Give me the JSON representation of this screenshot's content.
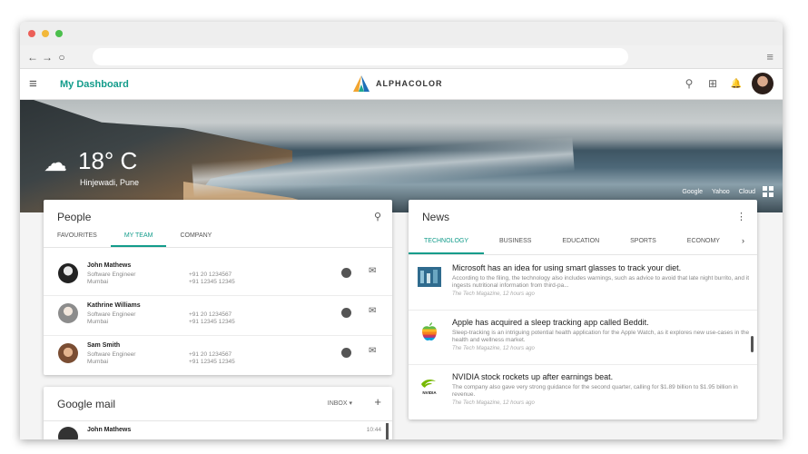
{
  "browser": {
    "back": "←",
    "forward": "→",
    "reload": "○",
    "menu": "≡"
  },
  "appbar": {
    "menu_icon": "≡",
    "title": "My Dashboard",
    "brand": "ALPHACOLOR",
    "search_icon": "⚲",
    "apps_icon": "⊞",
    "bell_icon": "🔔"
  },
  "weather": {
    "icon": "☁",
    "temperature": "18° C",
    "location": "Hinjewadi, Pune"
  },
  "hero_links": [
    "Google",
    "Yahoo",
    "Cloud"
  ],
  "people": {
    "title": "People",
    "search_icon": "⚲",
    "tabs": [
      "FAVOURITES",
      "MY TEAM",
      "COMPANY"
    ],
    "active_tab": "MY TEAM",
    "contacts": [
      {
        "name": "John Mathews",
        "role": "Software Engineer",
        "city": "Mumbai",
        "phone1": "+91 20 1234567",
        "phone2": "+91 12345 12345"
      },
      {
        "name": "Kathrine Williams",
        "role": "Software Engineer",
        "city": "Mumbai",
        "phone1": "+91 20 1234567",
        "phone2": "+91 12345 12345"
      },
      {
        "name": "Sam Smith",
        "role": "Software Engineer",
        "city": "Mumbai",
        "phone1": "+91 20 1234567",
        "phone2": "+91 12345 12345"
      }
    ]
  },
  "news": {
    "title": "News",
    "more_icon": "⋮",
    "tabs": [
      "TECHNOLOGY",
      "BUSINESS",
      "EDUCATION",
      "SPORTS",
      "ECONOMY"
    ],
    "active_tab": "TECHNOLOGY",
    "next_icon": "›",
    "articles": [
      {
        "title": "Microsoft has an idea for using smart glasses to track your diet.",
        "body": "According to the filing, the technology also includes warnings, such as advice to avoid that late night burrito, and it ingests nutritional information from third-pa...",
        "meta": "The Tech Magazine, 12 hours ago"
      },
      {
        "title": "Apple has acquired a sleep tracking app called Beddit.",
        "body": "Sleep-tracking is an intriguing potential health application for the Apple Watch, as it explores new use-cases in the health and wellness market.",
        "meta": "The Tech Magazine, 12 hours ago"
      },
      {
        "title": "NVIDIA stock rockets up after earnings beat.",
        "body": "The company also gave very strong guidance for the second quarter, calling for $1.89 billion to $1.95 billion in revenue.",
        "meta": "The Tech Magazine, 12 hours ago",
        "thumb_label": "NVIDIA"
      }
    ]
  },
  "gmail": {
    "title": "Google mail",
    "inbox_label": "INBOX ▾",
    "add_icon": "+",
    "first_sender": "John Mathews",
    "first_time": "10:44"
  },
  "colors": {
    "accent": "#139c8b"
  }
}
